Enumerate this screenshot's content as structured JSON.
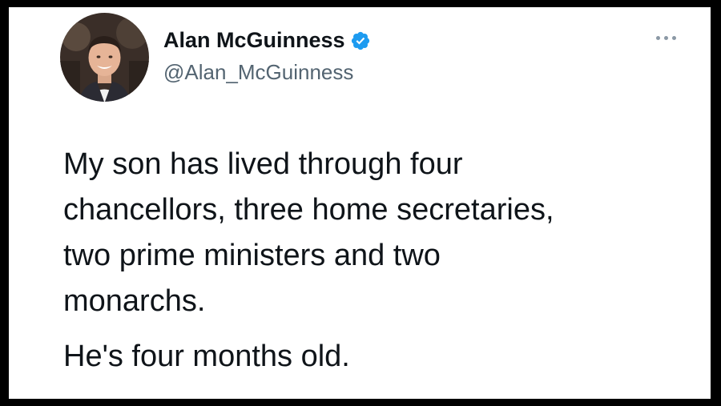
{
  "tweet": {
    "author": {
      "display_name": "Alan McGuinness",
      "handle": "@Alan_McGuinness",
      "verified": true,
      "avatar_icon": "profile-photo"
    },
    "more_icon": "more-horizontal-icon",
    "text_paragraphs": [
      "My son has lived through four\nchancellors, three home secretaries,\ntwo prime ministers and two\nmonarchs.",
      "He's four months old."
    ]
  },
  "colors": {
    "frame_border": "#000000",
    "background": "#ffffff",
    "text": "#0f1419",
    "handle_text": "#536471",
    "verified_badge": "#1d9bf0",
    "more_dots": "#8b98a5"
  }
}
